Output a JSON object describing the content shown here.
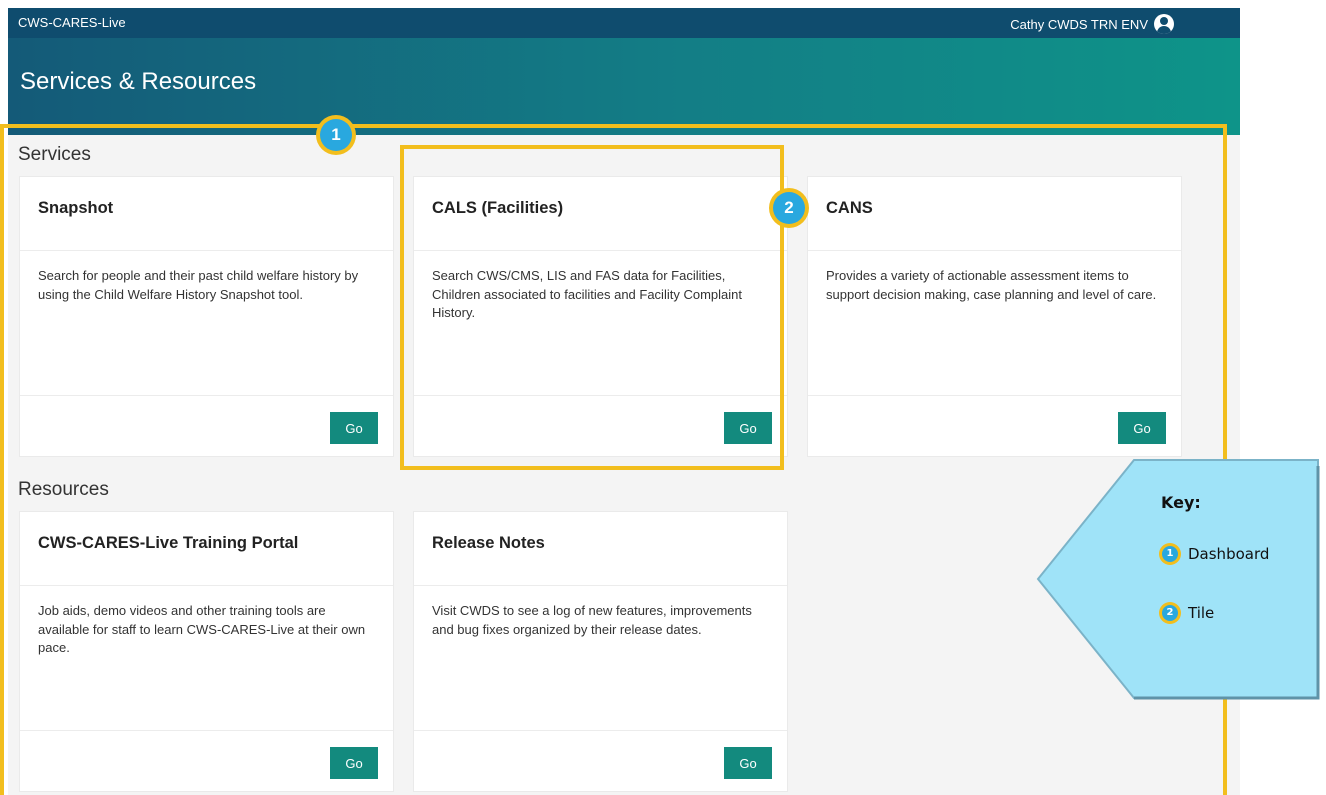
{
  "app": {
    "name": "CWS-CARES-Live",
    "user_name": "Cathy CWDS TRN ENV"
  },
  "page": {
    "title": "Services & Resources"
  },
  "sections": {
    "services": {
      "title": "Services",
      "tiles": [
        {
          "title": "Snapshot",
          "description": "Search for people and their past child welfare history by using the Child Welfare History Snapshot tool.",
          "button": "Go"
        },
        {
          "title": "CALS (Facilities)",
          "description": "Search CWS/CMS, LIS and FAS data for Facilities, Children associated to facilities and Facility Complaint History.",
          "button": "Go"
        },
        {
          "title": "CANS",
          "description": "Provides a variety of actionable assessment items to support decision making, case planning and level of care.",
          "button": "Go"
        }
      ]
    },
    "resources": {
      "title": "Resources",
      "tiles": [
        {
          "title": "CWS-CARES-Live Training Portal",
          "description": "Job aids, demo videos and other training tools are available for staff to learn CWS-CARES-Live at their own pace.",
          "button": "Go"
        },
        {
          "title": "Release Notes",
          "description": "Visit CWDS to see a log of new features, improvements and bug fixes organized by their release dates.",
          "button": "Go"
        }
      ]
    }
  },
  "annotations": {
    "badges": [
      "1",
      "2"
    ],
    "key": {
      "title": "Key:",
      "items": [
        {
          "number": "1",
          "label": "Dashboard"
        },
        {
          "number": "2",
          "label": "Tile"
        }
      ]
    }
  },
  "colors": {
    "topbar": "#0f4c6e",
    "header_start": "#145a78",
    "header_end": "#0e9489",
    "button": "#138a7e",
    "highlight": "#f2be1d",
    "badge": "#29a8df",
    "key_fill": "#9fe3f8"
  },
  "icons": {
    "user": "user-circle-icon"
  }
}
